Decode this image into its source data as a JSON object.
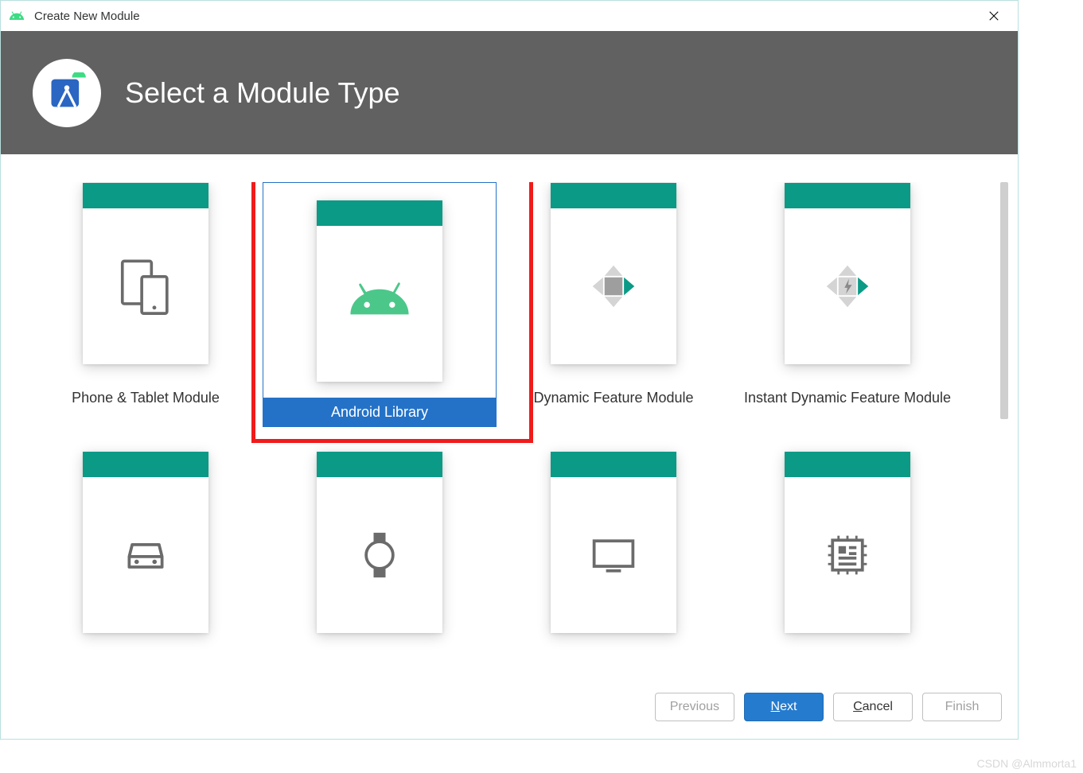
{
  "window": {
    "title": "Create New Module"
  },
  "header": {
    "title": "Select a Module Type"
  },
  "modules": [
    {
      "label": "Phone & Tablet Module",
      "icon": "phone-tablet",
      "selected": false
    },
    {
      "label": "Android Library",
      "icon": "android",
      "selected": true,
      "highlight": true
    },
    {
      "label": "Dynamic Feature Module",
      "icon": "dynamic",
      "selected": false
    },
    {
      "label": "Instant Dynamic Feature Module",
      "icon": "instant-dynamic",
      "selected": false
    },
    {
      "label": "",
      "icon": "car",
      "selected": false
    },
    {
      "label": "",
      "icon": "watch",
      "selected": false
    },
    {
      "label": "",
      "icon": "tv",
      "selected": false
    },
    {
      "label": "",
      "icon": "things",
      "selected": false
    }
  ],
  "footer": {
    "previous": "Previous",
    "next": "Next",
    "cancel": "Cancel",
    "finish": "Finish"
  },
  "watermark": "CSDN @Almmorta1"
}
